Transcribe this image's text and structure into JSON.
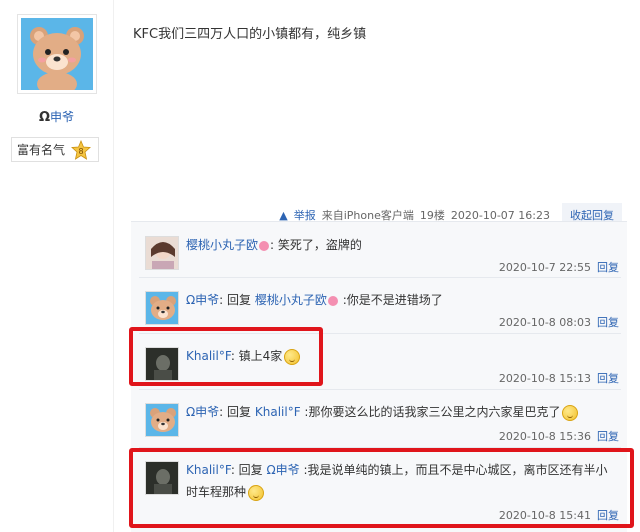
{
  "user": {
    "omega": "Ω",
    "name": "申爷",
    "badge_label": "富有名气",
    "badge_level": "8"
  },
  "post": {
    "text": "KFC我们三四万人口的小镇都有，纯乡镇",
    "report": "举报",
    "source": "来自iPhone客户端",
    "floor": "19楼",
    "time": "2020-10-07 16:23",
    "collapse": "收起回复"
  },
  "replies": [
    {
      "user": "樱桃小丸子欧",
      "text": ": 笑死了，盗牌的",
      "time": "2020-10-7 22:55",
      "action": "回复"
    },
    {
      "user": "Ω申爷",
      "reply_word": ": 回复 ",
      "target": "樱桃小丸子欧",
      "text": " :你是不是进错场了",
      "time": "2020-10-8 08:03",
      "action": "回复"
    },
    {
      "user": "Khalil°F",
      "text": ": 镇上4家",
      "time": "2020-10-8 15:13",
      "action": "回复"
    },
    {
      "user": "Ω申爷",
      "reply_word": ": 回复 ",
      "target": "Khalil°F",
      "text": " :那你要这么比的话我家三公里之内六家星巴克了",
      "time": "2020-10-8 15:36",
      "action": "回复"
    },
    {
      "user": "Khalil°F",
      "reply_word": ": 回复 ",
      "target": "Ω申爷",
      "text": " :我是说单纯的镇上，而且不是中心城区，离市区还有半小",
      "text2": "时车程那种",
      "time": "2020-10-8 15:41",
      "action": "回复"
    }
  ]
}
